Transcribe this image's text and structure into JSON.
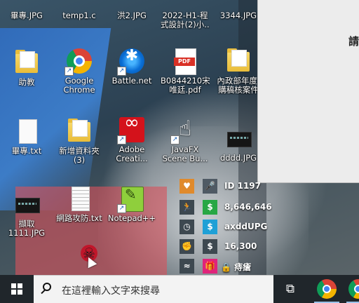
{
  "desktop_icons": [
    {
      "label": "畢專.JPG"
    },
    {
      "label": "temp1.c"
    },
    {
      "label": "洪2.JPG"
    },
    {
      "label": "2022-H1-程"
    },
    {
      "label": "式設計(2)小..."
    },
    {
      "label": "3344.JPG"
    },
    {
      "label": "助教"
    },
    {
      "label": "Google"
    },
    {
      "label": "Chrome"
    },
    {
      "label": "Battle.net"
    },
    {
      "label": "B0844210宋"
    },
    {
      "label": "唯廷.pdf"
    },
    {
      "label": "內政部年度."
    },
    {
      "label": "購稿核案件"
    },
    {
      "label": "畢專.txt"
    },
    {
      "label": "新增資料夾"
    },
    {
      "label": "(3)"
    },
    {
      "label": "Adobe"
    },
    {
      "label": "Creati..."
    },
    {
      "label": "JavaFX"
    },
    {
      "label": "Scene Bu..."
    },
    {
      "label": "dddd.JPG"
    },
    {
      "label": "擷取"
    },
    {
      "label": "1111.JPG"
    },
    {
      "label": "網路攻防.txt"
    },
    {
      "label": "Notepad++"
    }
  ],
  "window": {
    "partial_text": "請"
  },
  "overlay_panel": {
    "rows": [
      {
        "text": "ID 1197",
        "icon": "heart-icon",
        "sub_icon": "mic-off-icon"
      },
      {
        "text": "8,646,646",
        "icon": "running-icon",
        "sub_icon": "dollar-icon"
      },
      {
        "text": "axddUPG",
        "icon": "clock-icon",
        "sub_icon": "dollar-icon"
      },
      {
        "text": "16,300",
        "icon": "fist-icon",
        "sub_icon": "dollar-icon"
      },
      {
        "text": "🔒 痔瘡",
        "icon": "swim-icon",
        "sub_icon": "gift-icon"
      }
    ]
  },
  "taskbar": {
    "search_placeholder": "在這裡輸入文字來搜尋",
    "task_view_glyph": "⫿⃞"
  },
  "colors": {
    "selection": "#d6525c",
    "taskbar": "#20262b",
    "search_bg": "#f3f3f3"
  }
}
